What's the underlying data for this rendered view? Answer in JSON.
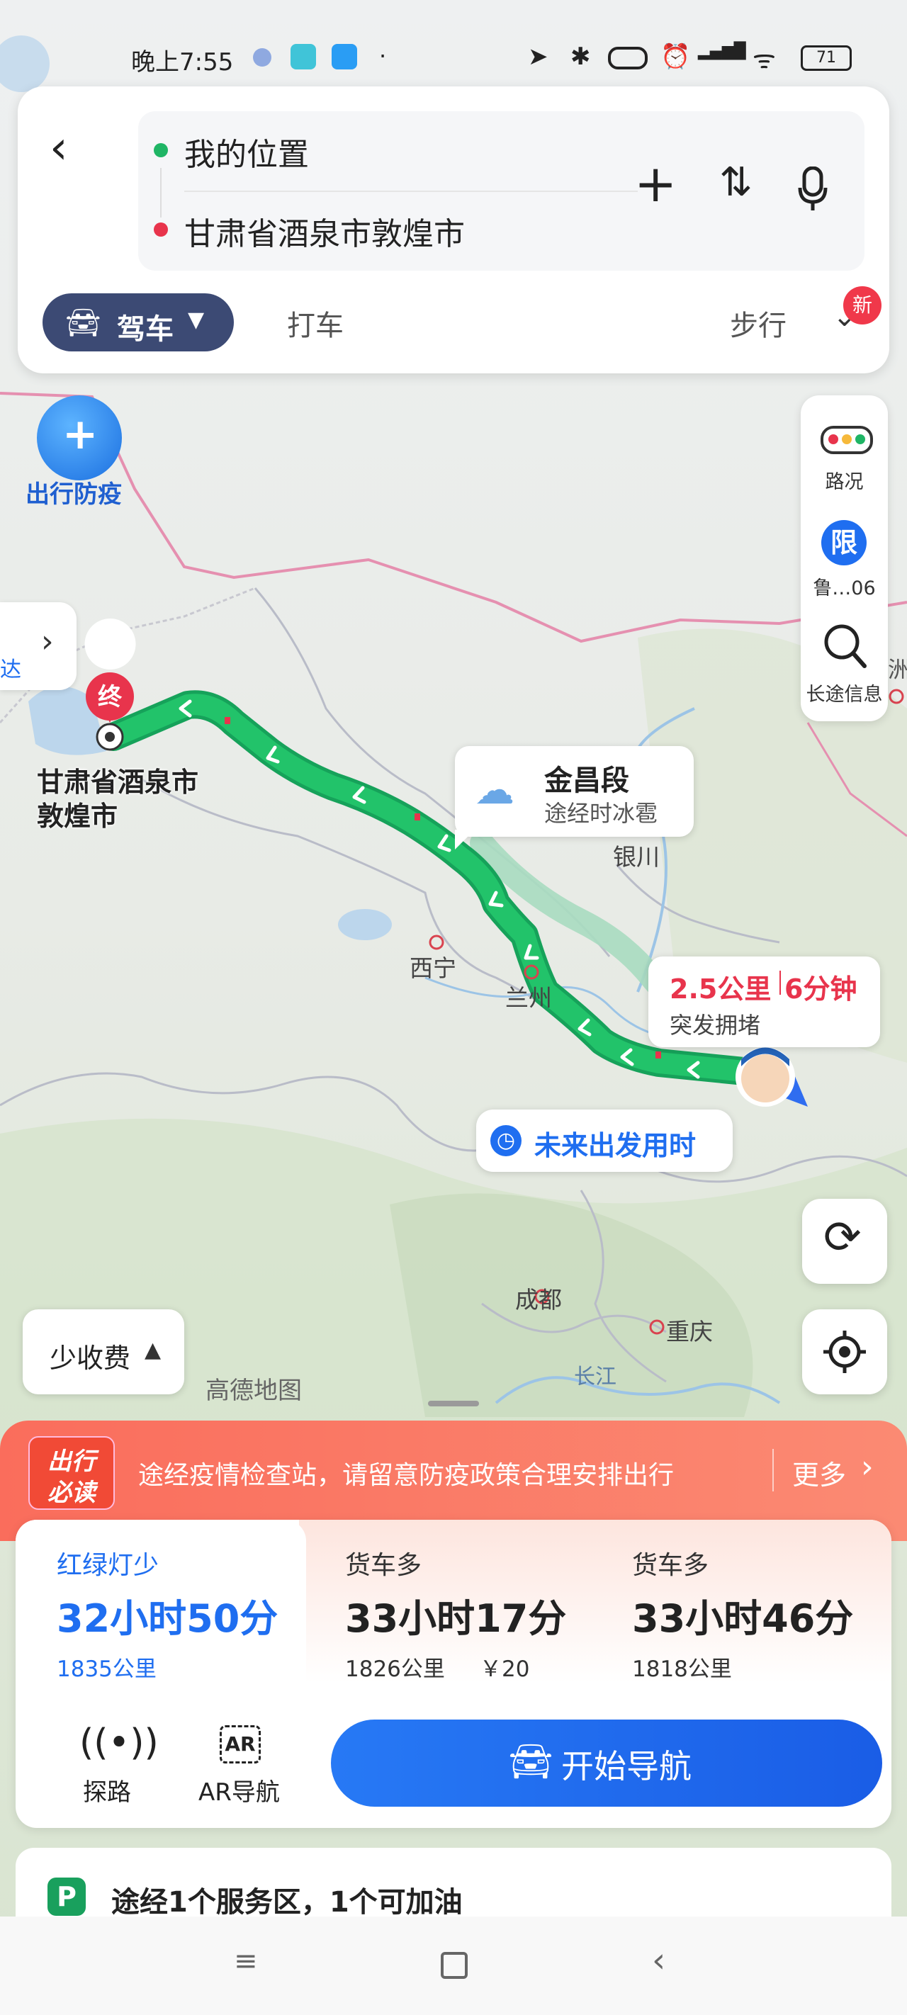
{
  "status_bar": {
    "time": "晚上7:55",
    "battery": "71"
  },
  "route_inputs": {
    "origin": "我的位置",
    "destination": "甘肃省酒泉市敦煌市"
  },
  "modes": {
    "drive": "驾车",
    "taxi": "打车",
    "walk": "步行",
    "new_badge": "新"
  },
  "epidemic_badge": "出行防疫",
  "side_tab": {
    "text": "达"
  },
  "map_tools": {
    "traffic": "路况",
    "restrict_icon": "限",
    "restrict": "鲁…06",
    "info": "长途信息"
  },
  "map": {
    "destination_marker": "终",
    "destination_label_line1": "甘肃省酒泉市",
    "destination_label_line2": "敦煌市",
    "cities": {
      "yinchuan": "银川",
      "xining": "西宁",
      "lanzhou": "兰州",
      "chengdu": "成都",
      "chongqing": "重庆",
      "changjiang": "长江"
    },
    "watermark": "高德地图",
    "edge_char": "洲"
  },
  "weather_tip": {
    "title": "金昌段",
    "subtitle": "途经时冰雹"
  },
  "jam_tip": {
    "distance": "2.5公里",
    "duration": "6分钟",
    "desc": "突发拥堵"
  },
  "future_btn": "未来出发用时",
  "toll_btn": "少收费",
  "notice": {
    "badge_line1": "出行",
    "badge_line2": "必读",
    "text": "途经疫情检查站，请留意防疫政策合理安排出行",
    "more": "更多"
  },
  "routes": [
    {
      "tag": "红绿灯少",
      "time": "32小时50分",
      "dist": "1835公里",
      "extra": ""
    },
    {
      "tag": "货车多",
      "time": "33小时17分",
      "dist": "1826公里",
      "extra": "￥20"
    },
    {
      "tag": "货车多",
      "time": "33小时46分",
      "dist": "1818公里",
      "extra": ""
    }
  ],
  "actions": {
    "explore": "探路",
    "ar": "AR导航",
    "ar_icon": "AR",
    "start": "开始导航"
  },
  "service": {
    "icon": "P",
    "text": "途经1个服务区，1个可加油"
  },
  "colors": {
    "route_green": "#1fb565",
    "accent_blue": "#1f6ef0",
    "red": "#e8344c"
  }
}
